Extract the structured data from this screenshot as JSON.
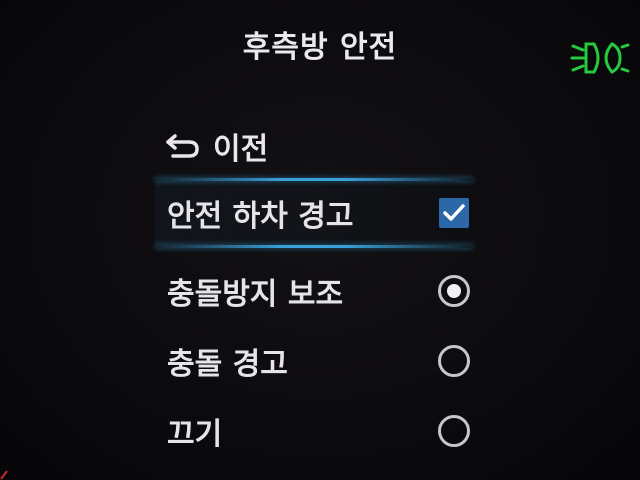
{
  "header": {
    "title": "후측방 안전"
  },
  "status": {
    "icon": "lights-indicator-icon",
    "color": "#27c93f"
  },
  "menu": {
    "back_label": "이전",
    "items": [
      {
        "label": "안전 하차 경고",
        "control": "checkbox",
        "checked": true,
        "selected": true
      },
      {
        "label": "충돌방지 보조",
        "control": "radio",
        "checked": true,
        "selected": false
      },
      {
        "label": "충돌 경고",
        "control": "radio",
        "checked": false,
        "selected": false
      },
      {
        "label": "끄기",
        "control": "radio",
        "checked": false,
        "selected": false
      }
    ]
  },
  "colors": {
    "background": "#0b0a0c",
    "text": "#e9e7ea",
    "selection_line": "#3aa0d8",
    "checkbox_fill": "#2c67a7",
    "indicator_green": "#27c93f"
  }
}
